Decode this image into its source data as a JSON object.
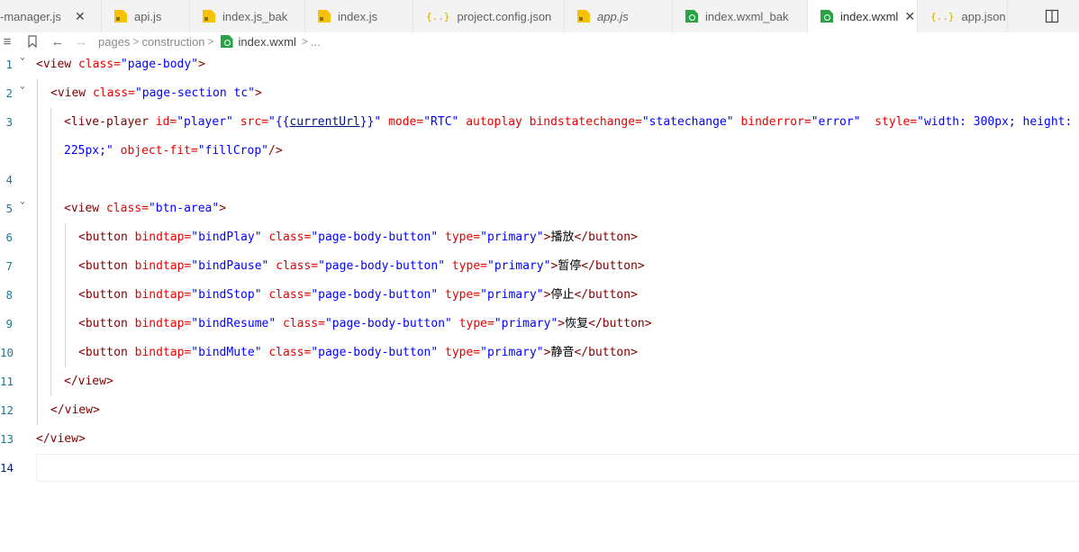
{
  "tabs": [
    {
      "label": "-manager.js",
      "icon": "js-file-icon",
      "close": "✕",
      "italic": false,
      "active": false
    },
    {
      "label": "api.js",
      "icon": "js-file-icon",
      "italic": false,
      "active": false
    },
    {
      "label": "index.js_bak",
      "icon": "js-file-icon",
      "italic": false,
      "active": false
    },
    {
      "label": "index.js",
      "icon": "js-file-icon",
      "italic": false,
      "active": false
    },
    {
      "label": "project.config.json",
      "icon": "json-file-icon",
      "italic": false,
      "active": false
    },
    {
      "label": "app.js",
      "icon": "js-file-icon",
      "italic": true,
      "active": false
    },
    {
      "label": "index.wxml_bak",
      "icon": "wxml-file-icon",
      "italic": false,
      "active": false
    },
    {
      "label": "index.wxml",
      "icon": "wxml-file-icon",
      "close": "✕",
      "italic": false,
      "active": true
    },
    {
      "label": "app.json",
      "icon": "json-file-icon",
      "italic": false,
      "active": false
    }
  ],
  "json_icon_glyph": "{..}",
  "breadcrumb": {
    "menu_glyph": "≡",
    "bookmark_glyph": "⛉",
    "back_glyph": "←",
    "forward_glyph": "→",
    "sep": ">",
    "items": [
      "pages",
      "construction",
      "index.wxml",
      "..."
    ]
  },
  "editor": {
    "lines": [
      {
        "num": "1",
        "fold": "⌄",
        "tokens": [
          [
            "tag",
            "<view "
          ],
          [
            "attr",
            "class="
          ],
          [
            "str",
            "\"page-body\""
          ],
          [
            "tag",
            ">"
          ]
        ]
      },
      {
        "num": "2",
        "fold": "⌄",
        "tokens": [
          [
            "tag",
            "<view "
          ],
          [
            "attr",
            "class="
          ],
          [
            "str",
            "\"page-section tc\""
          ],
          [
            "tag",
            ">"
          ]
        ]
      },
      {
        "num": "3",
        "fold": "",
        "tokens": [
          [
            "tag",
            "<live-player "
          ],
          [
            "attr",
            "id="
          ],
          [
            "str",
            "\"player\" "
          ],
          [
            "attr",
            "src="
          ],
          [
            "str",
            "\""
          ],
          [
            "tmpl",
            "{{"
          ],
          [
            "var",
            "currentUrl"
          ],
          [
            "tmpl",
            "}}"
          ],
          [
            "str",
            "\" "
          ],
          [
            "attr",
            "mode="
          ],
          [
            "str",
            "\"RTC\" "
          ],
          [
            "attr",
            "autoplay bindstatechange="
          ],
          [
            "str",
            "\"statechange\" "
          ],
          [
            "attr",
            "binderror="
          ],
          [
            "str",
            "\"error\"  "
          ],
          [
            "attr",
            "style="
          ],
          [
            "str",
            "\"width: 300px; height:"
          ]
        ]
      },
      {
        "num": "",
        "fold": "",
        "tokens": [
          [
            "str",
            "225px;\" "
          ],
          [
            "attr",
            "object-fit="
          ],
          [
            "str",
            "\"fillCrop\""
          ],
          [
            "tag",
            "/>"
          ]
        ]
      },
      {
        "num": "4",
        "fold": "",
        "tokens": []
      },
      {
        "num": "5",
        "fold": "⌄",
        "tokens": [
          [
            "tag",
            "<view "
          ],
          [
            "attr",
            "class="
          ],
          [
            "str",
            "\"btn-area\""
          ],
          [
            "tag",
            ">"
          ]
        ]
      },
      {
        "num": "6",
        "fold": "",
        "tokens": [
          [
            "tag",
            "<button "
          ],
          [
            "attr",
            "bindtap="
          ],
          [
            "str",
            "\"bindPlay\" "
          ],
          [
            "attr",
            "class="
          ],
          [
            "str",
            "\"page-body-button\" "
          ],
          [
            "attr",
            "type="
          ],
          [
            "str",
            "\"primary\""
          ],
          [
            "tag",
            ">"
          ],
          [
            "text",
            "播放"
          ],
          [
            "tag",
            "</button>"
          ]
        ]
      },
      {
        "num": "7",
        "fold": "",
        "tokens": [
          [
            "tag",
            "<button "
          ],
          [
            "attr",
            "bindtap="
          ],
          [
            "str",
            "\"bindPause\" "
          ],
          [
            "attr",
            "class="
          ],
          [
            "str",
            "\"page-body-button\" "
          ],
          [
            "attr",
            "type="
          ],
          [
            "str",
            "\"primary\""
          ],
          [
            "tag",
            ">"
          ],
          [
            "text",
            "暂停"
          ],
          [
            "tag",
            "</button>"
          ]
        ]
      },
      {
        "num": "8",
        "fold": "",
        "tokens": [
          [
            "tag",
            "<button "
          ],
          [
            "attr",
            "bindtap="
          ],
          [
            "str",
            "\"bindStop\" "
          ],
          [
            "attr",
            "class="
          ],
          [
            "str",
            "\"page-body-button\" "
          ],
          [
            "attr",
            "type="
          ],
          [
            "str",
            "\"primary\""
          ],
          [
            "tag",
            ">"
          ],
          [
            "text",
            "停止"
          ],
          [
            "tag",
            "</button>"
          ]
        ]
      },
      {
        "num": "9",
        "fold": "",
        "tokens": [
          [
            "tag",
            "<button "
          ],
          [
            "attr",
            "bindtap="
          ],
          [
            "str",
            "\"bindResume\" "
          ],
          [
            "attr",
            "class="
          ],
          [
            "str",
            "\"page-body-button\" "
          ],
          [
            "attr",
            "type="
          ],
          [
            "str",
            "\"primary\""
          ],
          [
            "tag",
            ">"
          ],
          [
            "text",
            "恢复"
          ],
          [
            "tag",
            "</button>"
          ]
        ]
      },
      {
        "num": "10",
        "fold": "",
        "tokens": [
          [
            "tag",
            "<button "
          ],
          [
            "attr",
            "bindtap="
          ],
          [
            "str",
            "\"bindMute\" "
          ],
          [
            "attr",
            "class="
          ],
          [
            "str",
            "\"page-body-button\" "
          ],
          [
            "attr",
            "type="
          ],
          [
            "str",
            "\"primary\""
          ],
          [
            "tag",
            ">"
          ],
          [
            "text",
            "静音"
          ],
          [
            "tag",
            "</button>"
          ]
        ]
      },
      {
        "num": "11",
        "fold": "",
        "tokens": [
          [
            "tag",
            "</view>"
          ]
        ]
      },
      {
        "num": "12",
        "fold": "",
        "tokens": [
          [
            "tag",
            "</view>"
          ]
        ]
      },
      {
        "num": "13",
        "fold": "",
        "tokens": [
          [
            "tag",
            "</view>"
          ]
        ]
      },
      {
        "num": "14",
        "fold": "",
        "tokens": [],
        "active": true
      }
    ]
  }
}
